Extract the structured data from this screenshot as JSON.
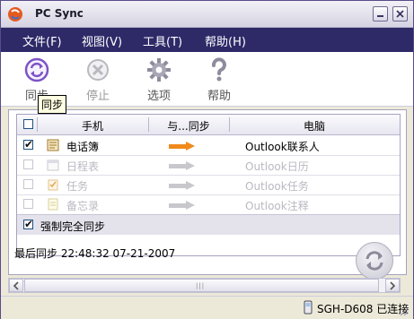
{
  "window": {
    "title": "PC Sync"
  },
  "menubar": {
    "items": [
      "文件(F)",
      "视图(V)",
      "工具(T)",
      "帮助(H)"
    ]
  },
  "toolbar": {
    "buttons": [
      {
        "label": "同步",
        "icon": "sync-icon",
        "enabled": true
      },
      {
        "label": "停止",
        "icon": "stop-icon",
        "enabled": false
      },
      {
        "label": "选项",
        "icon": "options-gear-icon",
        "enabled": true
      },
      {
        "label": "帮助",
        "icon": "help-icon",
        "enabled": true
      }
    ],
    "tooltip": "同步"
  },
  "grid": {
    "headers": {
      "phone": "手机",
      "direction": "与...同步",
      "pc": "电脑"
    },
    "rows": [
      {
        "name": "电话簿",
        "pc": "Outlook联系人",
        "checked": true,
        "enabled": true,
        "arrow_color": "#f08a1c"
      },
      {
        "name": "日程表",
        "pc": "Outlook日历",
        "checked": false,
        "enabled": false,
        "arrow_color": "#c8c8cc"
      },
      {
        "name": "任务",
        "pc": "Outlook任务",
        "checked": false,
        "enabled": false,
        "arrow_color": "#c8c8cc"
      },
      {
        "name": "备忘录",
        "pc": "Outlook注释",
        "checked": false,
        "enabled": false,
        "arrow_color": "#c8c8cc"
      }
    ],
    "force_sync": {
      "label": "强制完全同步",
      "checked": true
    }
  },
  "last_sync": {
    "text": "最后同步 22:48:32 07-21-2007"
  },
  "status": {
    "text": "SGH-D608 已连接"
  },
  "colors": {
    "menubar": "#2e2a68",
    "accent": "#7d53c5",
    "arrow_active": "#f08a1c"
  }
}
